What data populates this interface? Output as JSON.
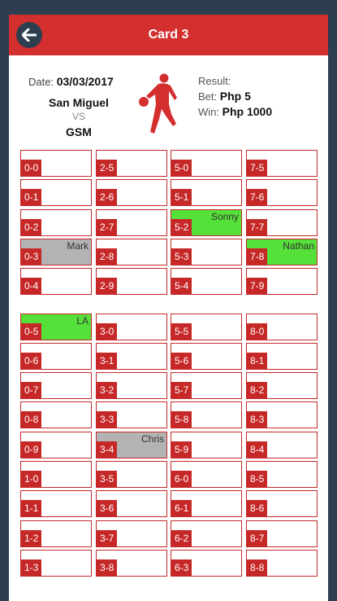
{
  "header": {
    "title": "Card 3"
  },
  "info": {
    "date_label": "Date:",
    "date": "03/03/2017",
    "team1": "San Miguel",
    "vs": "VS",
    "team2": "GSM",
    "result_label": "Result:",
    "bet_label": "Bet:",
    "bet_value": "Php 5",
    "win_label": "Win:",
    "win_value": "Php 1000"
  },
  "colors": {
    "accent": "#d32f2f",
    "background": "#2c3e50",
    "taken_green": "#55e03a",
    "taken_gray": "#b3b3b3"
  },
  "columns": [
    [
      {
        "num": "0-0",
        "name": "",
        "state": ""
      },
      {
        "num": "0-1",
        "name": "",
        "state": ""
      },
      {
        "num": "0-2",
        "name": "",
        "state": ""
      },
      {
        "num": "0-3",
        "name": "Mark",
        "state": "gray"
      },
      {
        "num": "0-4",
        "name": "",
        "state": ""
      },
      {
        "num": "0-5",
        "name": "LA",
        "state": "green"
      },
      {
        "num": "0-6",
        "name": "",
        "state": ""
      },
      {
        "num": "0-7",
        "name": "",
        "state": ""
      },
      {
        "num": "0-8",
        "name": "",
        "state": ""
      },
      {
        "num": "0-9",
        "name": "",
        "state": ""
      },
      {
        "num": "1-0",
        "name": "",
        "state": ""
      },
      {
        "num": "1-1",
        "name": "",
        "state": ""
      },
      {
        "num": "1-2",
        "name": "",
        "state": ""
      },
      {
        "num": "1-3",
        "name": "",
        "state": ""
      }
    ],
    [
      {
        "num": "2-5",
        "name": "",
        "state": ""
      },
      {
        "num": "2-6",
        "name": "",
        "state": ""
      },
      {
        "num": "2-7",
        "name": "",
        "state": ""
      },
      {
        "num": "2-8",
        "name": "",
        "state": ""
      },
      {
        "num": "2-9",
        "name": "",
        "state": ""
      },
      {
        "num": "3-0",
        "name": "",
        "state": ""
      },
      {
        "num": "3-1",
        "name": "",
        "state": ""
      },
      {
        "num": "3-2",
        "name": "",
        "state": ""
      },
      {
        "num": "3-3",
        "name": "",
        "state": ""
      },
      {
        "num": "3-4",
        "name": "Chris",
        "state": "gray"
      },
      {
        "num": "3-5",
        "name": "",
        "state": ""
      },
      {
        "num": "3-6",
        "name": "",
        "state": ""
      },
      {
        "num": "3-7",
        "name": "",
        "state": ""
      },
      {
        "num": "3-8",
        "name": "",
        "state": ""
      }
    ],
    [
      {
        "num": "5-0",
        "name": "",
        "state": ""
      },
      {
        "num": "5-1",
        "name": "",
        "state": ""
      },
      {
        "num": "5-2",
        "name": "Sonny",
        "state": "green"
      },
      {
        "num": "5-3",
        "name": "",
        "state": ""
      },
      {
        "num": "5-4",
        "name": "",
        "state": ""
      },
      {
        "num": "5-5",
        "name": "",
        "state": ""
      },
      {
        "num": "5-6",
        "name": "",
        "state": ""
      },
      {
        "num": "5-7",
        "name": "",
        "state": ""
      },
      {
        "num": "5-8",
        "name": "",
        "state": ""
      },
      {
        "num": "5-9",
        "name": "",
        "state": ""
      },
      {
        "num": "6-0",
        "name": "",
        "state": ""
      },
      {
        "num": "6-1",
        "name": "",
        "state": ""
      },
      {
        "num": "6-2",
        "name": "",
        "state": ""
      },
      {
        "num": "6-3",
        "name": "",
        "state": ""
      }
    ],
    [
      {
        "num": "7-5",
        "name": "",
        "state": ""
      },
      {
        "num": "7-6",
        "name": "",
        "state": ""
      },
      {
        "num": "7-7",
        "name": "",
        "state": ""
      },
      {
        "num": "7-8",
        "name": "Nathan",
        "state": "green"
      },
      {
        "num": "7-9",
        "name": "",
        "state": ""
      },
      {
        "num": "8-0",
        "name": "",
        "state": ""
      },
      {
        "num": "8-1",
        "name": "",
        "state": ""
      },
      {
        "num": "8-2",
        "name": "",
        "state": ""
      },
      {
        "num": "8-3",
        "name": "",
        "state": ""
      },
      {
        "num": "8-4",
        "name": "",
        "state": ""
      },
      {
        "num": "8-5",
        "name": "",
        "state": ""
      },
      {
        "num": "8-6",
        "name": "",
        "state": ""
      },
      {
        "num": "8-7",
        "name": "",
        "state": ""
      },
      {
        "num": "8-8",
        "name": "",
        "state": ""
      }
    ]
  ]
}
